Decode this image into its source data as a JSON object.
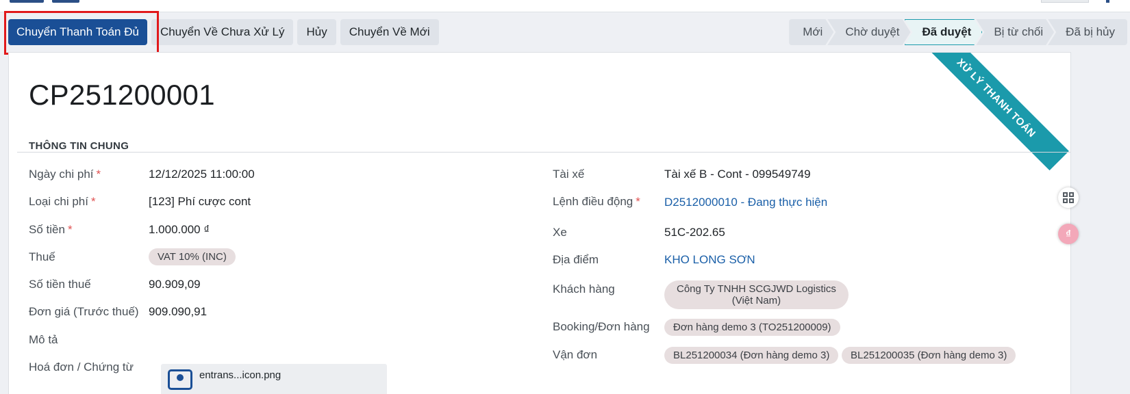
{
  "actions": {
    "primary": "Chuyển Thanh Toán Đủ",
    "to_unprocessed": "Chuyển Về Chưa Xử Lý",
    "cancel": "Hủy",
    "to_new": "Chuyển Về Mới"
  },
  "status": {
    "stages": [
      "Mới",
      "Chờ duyệt",
      "Đã duyệt",
      "Bị từ chối",
      "Đã bị hủy"
    ],
    "active": "Đã duyệt",
    "active_color": "#1b9aab"
  },
  "ribbon": {
    "text": "XỬ LÝ THANH TOÁN",
    "color": "#1b9aab"
  },
  "record": {
    "title": "CP251200001",
    "section": "THÔNG TIN CHUNG"
  },
  "left_fields": {
    "date": {
      "label": "Ngày chi phí",
      "value": "12/12/2025 11:00:00",
      "required": "*"
    },
    "type": {
      "label": "Loại chi phí",
      "value": "[123] Phí cược cont",
      "required": "*"
    },
    "amount": {
      "label": "Số tiền",
      "value": "1.000.000 ₫",
      "required": "*"
    },
    "tax": {
      "label": "Thuế",
      "value": "VAT 10% (INC)"
    },
    "tax_amount": {
      "label": "Số tiền thuế",
      "value": "90.909,09"
    },
    "unit_price": {
      "label": "Đơn giá (Trước thuế)",
      "value": "909.090,91"
    },
    "description": {
      "label": "Mô tả",
      "value": ""
    },
    "invoice": {
      "label": "Hoá đơn / Chứng từ",
      "file": "entrans...icon.png"
    }
  },
  "right_fields": {
    "driver": {
      "label": "Tài xế",
      "value": "Tài xế B - Cont - 099549749"
    },
    "dispatch": {
      "label": "Lệnh điều động",
      "value": "D2512000010 - Đang thực hiện",
      "required": "*"
    },
    "vehicle": {
      "label": "Xe",
      "value": "51C-202.65"
    },
    "location": {
      "label": "Địa điểm",
      "value": "KHO LONG SƠN"
    },
    "customer": {
      "label": "Khách hàng",
      "line1": "Công Ty TNHH SCGJWD Logistics",
      "line2": "(Việt Nam)"
    },
    "booking": {
      "label": "Booking/Đơn hàng",
      "value": "Đơn hàng demo 3 (TO251200009)"
    },
    "bill": {
      "label": "Vận đơn",
      "values": [
        "BL251200034 (Đơn hàng demo 3)",
        "BL251200035 (Đơn hàng demo 3)"
      ]
    }
  },
  "side": {
    "grid_icon": "grid-icon",
    "pink_badge": "₫"
  },
  "colors": {
    "primary": "#1a4f96",
    "link": "#1a5fa8",
    "highlight": "#e1191b"
  }
}
